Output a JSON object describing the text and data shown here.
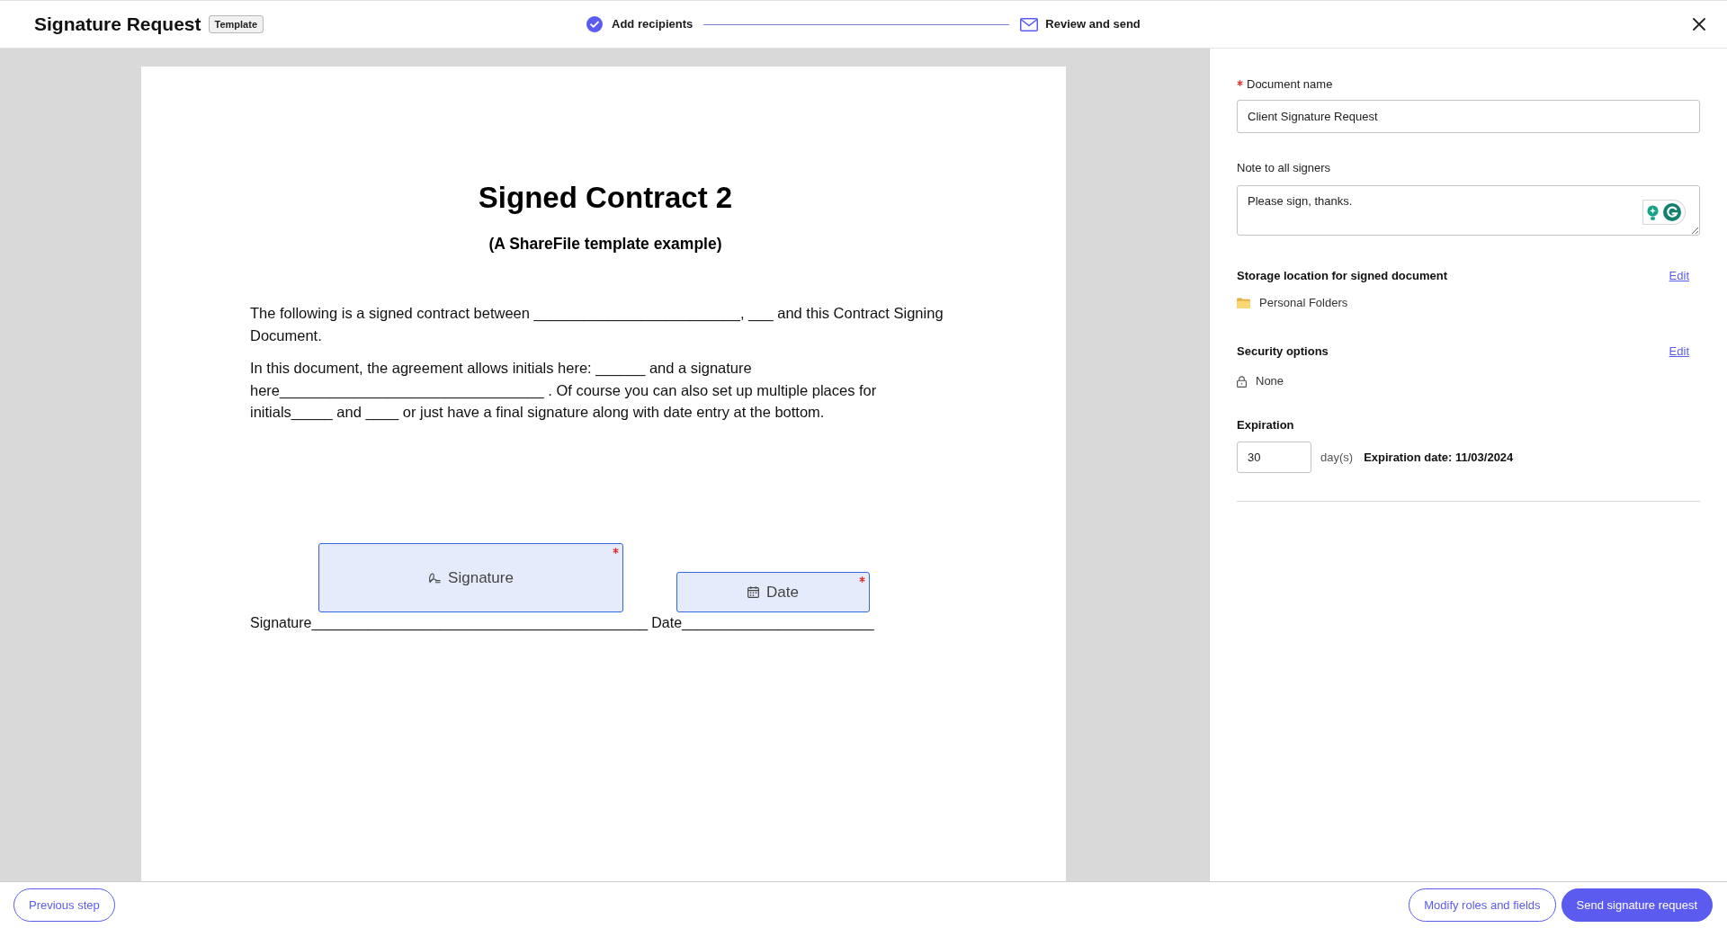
{
  "header": {
    "title": "Signature Request",
    "badge": "Template",
    "steps": [
      {
        "label": "Add recipients",
        "completed": true
      },
      {
        "label": "Review and send",
        "completed": false
      }
    ]
  },
  "document": {
    "title": "Signed Contract 2",
    "subtitle": "(A ShareFile template example)",
    "paragraphs": [
      "The following is a signed contract between _________________________, ___ and this Contract Signing Document.",
      "In this document, the agreement allows initials here: ______ and a signature here________________________________ . Of course you can also set up multiple places for initials_____ and ____ or just have a final signature along with date entry at the bottom."
    ],
    "signature_line": [
      "Signature__________________________________________",
      "Date________________________"
    ],
    "fields": [
      {
        "kind": "signature",
        "label": "Signature",
        "required": true
      },
      {
        "kind": "date",
        "label": "Date",
        "required": true
      }
    ]
  },
  "panel": {
    "document_name": {
      "label": "Document name",
      "required": true,
      "value": "Client Signature Request"
    },
    "note": {
      "label": "Note to all signers",
      "value": "Please sign, thanks."
    },
    "storage": {
      "heading": "Storage location for signed document",
      "action": "Edit",
      "value": "Personal Folders"
    },
    "security": {
      "heading": "Security options",
      "action": "Edit",
      "value": "None"
    },
    "expiration": {
      "heading": "Expiration",
      "days": "30",
      "unit": "day(s)",
      "date": "Expiration date: 11/03/2024"
    }
  },
  "footer": {
    "back": "Previous step",
    "buttons": [
      {
        "label": "Modify roles and fields",
        "primary": false
      },
      {
        "label": "Send signature request",
        "primary": true
      }
    ]
  }
}
